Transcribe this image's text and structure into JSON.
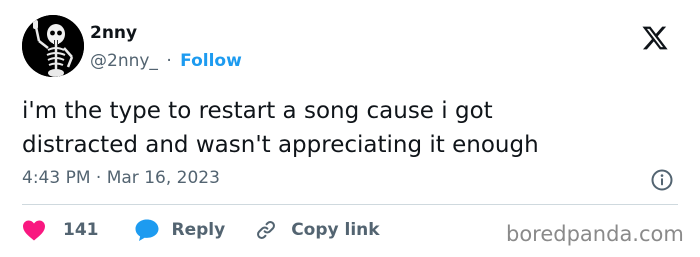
{
  "author": {
    "display_name": "2nny",
    "handle": "@2nny_",
    "separator": "·",
    "follow_label": "Follow",
    "avatar_icon": "skeleton-avatar-icon"
  },
  "platform_icon": "x-logo-icon",
  "tweet": {
    "text": "i'm the type to restart a song cause i got\ndistracted and wasn't appreciating it enough",
    "timestamp": "4:43 PM · Mar 16, 2023"
  },
  "actions": {
    "like_count": "141",
    "reply_label": "Reply",
    "copy_link_label": "Copy link"
  },
  "watermark": "boredpanda.com",
  "colors": {
    "accent": "#1d9bf0",
    "like": "#f91880",
    "muted_text": "#536471",
    "divider": "#cfd9de"
  }
}
